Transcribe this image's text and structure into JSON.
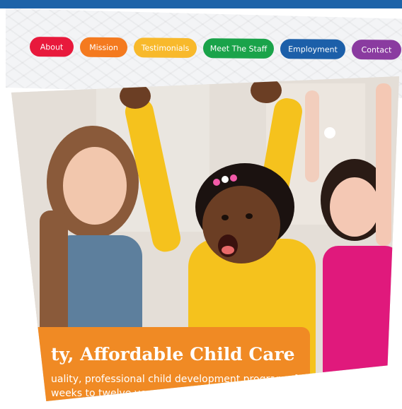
{
  "nav": {
    "items": [
      {
        "label": "About",
        "color": "#e8193c"
      },
      {
        "label": "Mission",
        "color": "#f47a1f"
      },
      {
        "label": "Testimonials",
        "color": "#f8b92b"
      },
      {
        "label": "Meet The Staff",
        "color": "#1aa34a"
      },
      {
        "label": "Employment",
        "color": "#1c5fa9"
      },
      {
        "label": "Contact",
        "color": "#8a3ba0"
      }
    ]
  },
  "hero": {
    "title": "ty, Affordable Child Care",
    "line1": "uality, professional child development programs f",
    "line2": "weeks to twelve years at price",
    "banner_color": "#f08a24",
    "top_bar_color": "#1d63a8"
  }
}
